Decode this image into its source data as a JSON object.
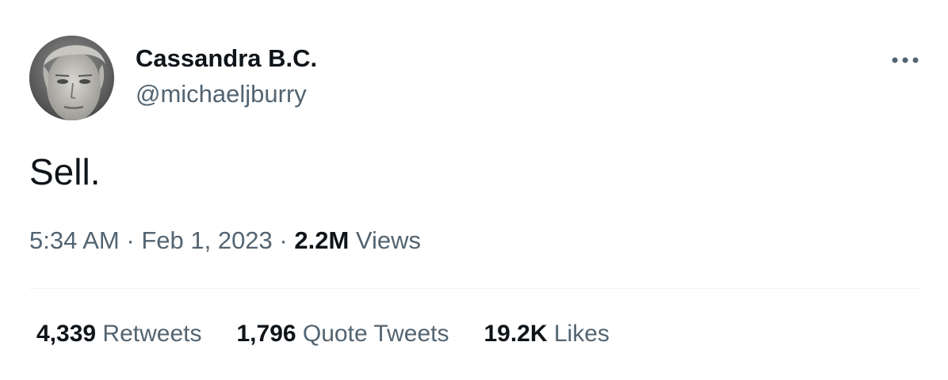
{
  "author": {
    "display_name": "Cassandra B.C.",
    "handle": "@michaeljburry"
  },
  "tweet": {
    "text": "Sell.",
    "time": "5:34 AM",
    "separator": "·",
    "date": "Feb 1, 2023",
    "views_count": "2.2M",
    "views_label": "Views"
  },
  "stats": {
    "retweets_count": "4,339",
    "retweets_label": "Retweets",
    "quotes_count": "1,796",
    "quotes_label": "Quote Tweets",
    "likes_count": "19.2K",
    "likes_label": "Likes"
  },
  "icons": {
    "more": "more-horizontal-icon"
  },
  "colors": {
    "primary_text": "#0f1419",
    "secondary_text": "#536471",
    "divider": "#eff3f4"
  }
}
